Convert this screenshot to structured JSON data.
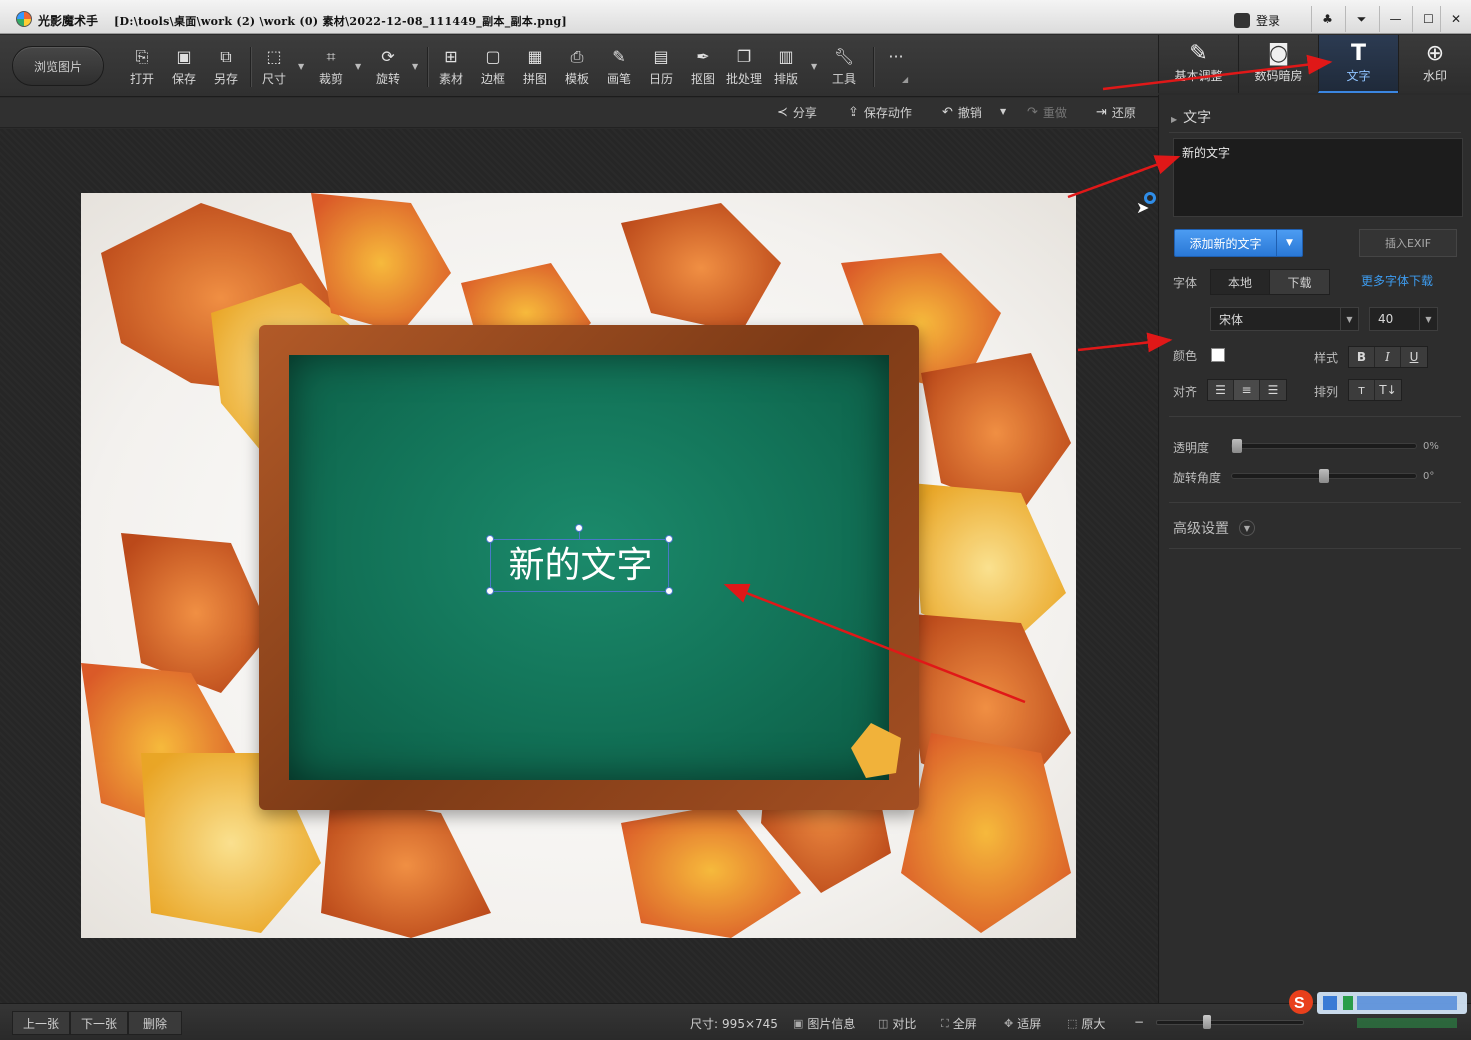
{
  "titlebar": {
    "app_name": "光影魔术手",
    "file_path": "[D:\\tools\\桌面\\work (2) \\work (0) 素材\\2022-12-08_111449_副本_副本.png]",
    "login_label": "登录"
  },
  "toolbar": {
    "browse_label": "浏览图片",
    "tools": [
      {
        "label": "打开",
        "icon": "open-icon"
      },
      {
        "label": "保存",
        "icon": "save-icon"
      },
      {
        "label": "另存",
        "icon": "save-as-icon"
      },
      {
        "label": "尺寸",
        "icon": "resize-icon"
      },
      {
        "label": "裁剪",
        "icon": "crop-icon"
      },
      {
        "label": "旋转",
        "icon": "rotate-icon"
      },
      {
        "label": "素材",
        "icon": "material-icon"
      },
      {
        "label": "边框",
        "icon": "border-icon"
      },
      {
        "label": "拼图",
        "icon": "collage-icon"
      },
      {
        "label": "模板",
        "icon": "template-icon"
      },
      {
        "label": "画笔",
        "icon": "brush-icon"
      },
      {
        "label": "日历",
        "icon": "calendar-icon"
      },
      {
        "label": "抠图",
        "icon": "cutout-icon"
      },
      {
        "label": "批处理",
        "icon": "batch-icon"
      },
      {
        "label": "排版",
        "icon": "layout-icon"
      },
      {
        "label": "工具",
        "icon": "wrench-icon"
      }
    ],
    "more_label": "···"
  },
  "right_tabs": [
    {
      "label": "基本调整",
      "icon": "basic-adjust-icon",
      "active": false
    },
    {
      "label": "数码暗房",
      "icon": "darkroom-icon",
      "active": false
    },
    {
      "label": "文字",
      "icon": "text-icon",
      "active": true
    },
    {
      "label": "水印",
      "icon": "watermark-icon",
      "active": false
    }
  ],
  "actionbar": {
    "share": "分享",
    "save_action": "保存动作",
    "undo": "撤销",
    "redo": "重做",
    "restore": "还原"
  },
  "canvas": {
    "overlay_text": "新的文字"
  },
  "panel": {
    "section_title": "文字",
    "text_value": "新的文字",
    "add_text_label": "添加新的文字",
    "insert_exif_label": "插入EXIF",
    "font_label": "字体",
    "font_source_local": "本地",
    "font_source_download": "下载",
    "more_fonts_link": "更多字体下载",
    "font_family": "宋体",
    "font_size": "40",
    "color_label": "颜色",
    "text_color": "#ffffff",
    "style_label": "样式",
    "style_bold": "B",
    "style_italic": "I",
    "style_underline": "U",
    "align_label": "对齐",
    "arrange_label": "排列",
    "opacity_label": "透明度",
    "opacity_value": "0%",
    "opacity_fraction": 0.0,
    "rotation_label": "旋转角度",
    "rotation_value": "0°",
    "rotation_fraction": 0.5,
    "advanced_label": "高级设置"
  },
  "statusbar": {
    "prev": "上一张",
    "next": "下一张",
    "delete": "删除",
    "size_label": "尺寸:",
    "size_value": "995×745",
    "info": "图片信息",
    "compare": "对比",
    "fullscreen": "全屏",
    "fit": "适屏",
    "original": "原大",
    "zoom_fraction": 0.33
  },
  "colors": {
    "accent": "#3b86e0",
    "annotation_arrow": "#e01818",
    "link": "#3d9cf0"
  }
}
